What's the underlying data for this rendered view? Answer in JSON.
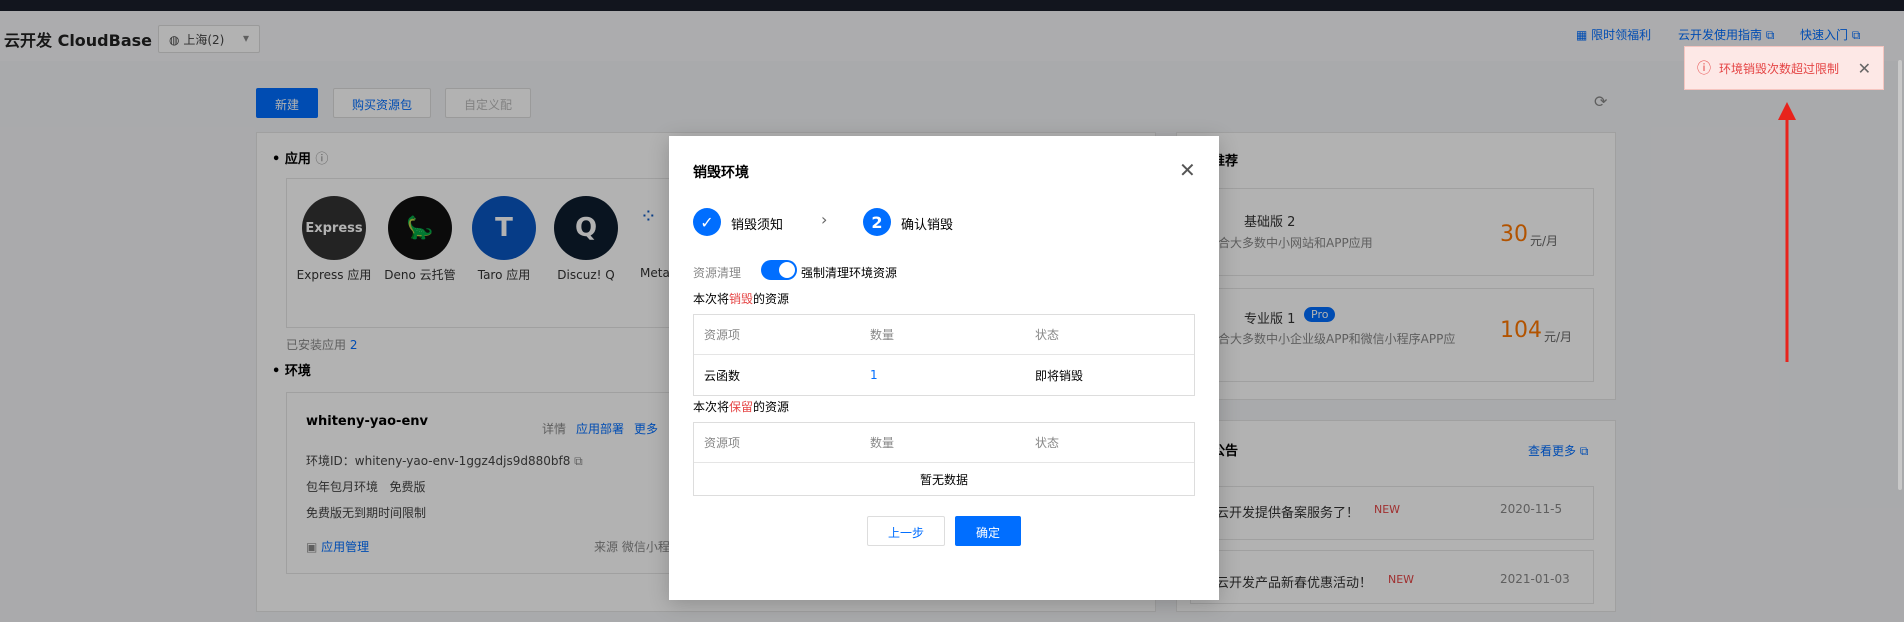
{
  "header": {
    "logo": "云开发 CloudBase",
    "region": "上海(2)",
    "links": [
      "限时领福利",
      "云开发使用指南",
      "快速入门"
    ]
  },
  "toolbar": {
    "new": "新建",
    "buy": "购买资源包",
    "third": "自定义配"
  },
  "apps_section": {
    "title": "应用",
    "apps": [
      {
        "label": "Express 应用",
        "icon_name": "express-icon"
      },
      {
        "label": "Deno 云托管",
        "icon_name": "deno-icon"
      },
      {
        "label": "Taro 应用",
        "icon_name": "taro-icon"
      },
      {
        "label": "Discuz! Q",
        "icon_name": "discuz-icon"
      },
      {
        "label": "Meta",
        "icon_name": "meta-icon"
      }
    ],
    "installed_label": "已安装应用",
    "installed_count": "2"
  },
  "env_section": {
    "title": "环境",
    "env_name": "whiteny-yao-env",
    "actions": [
      "详情",
      "应用部署",
      "更多"
    ],
    "env_id": "环境ID：whiteny-yao-env-1ggz4djs9d880bf8",
    "billing": "包年包月环境",
    "plan": "免费版",
    "note": "免费版无到期时间限制",
    "manage": "应用管理",
    "source": "来源 微信小程"
  },
  "right_panel": {
    "recommend_title": "推荐",
    "plans": [
      {
        "name": "基础版 2",
        "desc": "适合大多数中小网站和APP应用",
        "price": "30",
        "unit": "元/月",
        "badge": ""
      },
      {
        "name": "专业版 1",
        "desc": "适合大多数中小企业级APP和微信小程序APP应",
        "price": "104",
        "unit": "元/月",
        "badge": "Pro"
      }
    ],
    "news_title": "公告",
    "news_more": "查看更多",
    "news": [
      {
        "title": "云开发提供备案服务了！",
        "badge": "NEW",
        "date": "2020-11-5"
      },
      {
        "title": "云开发产品新春优惠活动！",
        "badge": "NEW",
        "date": "2021-01-03"
      }
    ]
  },
  "modal": {
    "title": "销毁环境",
    "step1": "销毁须知",
    "step2_num": "2",
    "step2": "确认销毁",
    "cleanup_label": "资源清理",
    "cleanup_toggle": "强制清理环境资源",
    "destroy_prefix": "本次将",
    "destroy_word": "销毁",
    "destroy_suffix": "的资源",
    "keep_word": "保留",
    "headers": [
      "资源项",
      "数量",
      "状态"
    ],
    "destroy_rows": [
      {
        "item": "云函数",
        "count": "1",
        "status": "即将销毁"
      }
    ],
    "empty": "暂无数据",
    "prev": "上一步",
    "confirm": "确定"
  },
  "toast": {
    "message": "环境销毁次数超过限制"
  },
  "colors": {
    "accent": "#006eff",
    "danger": "#e54545",
    "arrow": "#e8231c"
  }
}
